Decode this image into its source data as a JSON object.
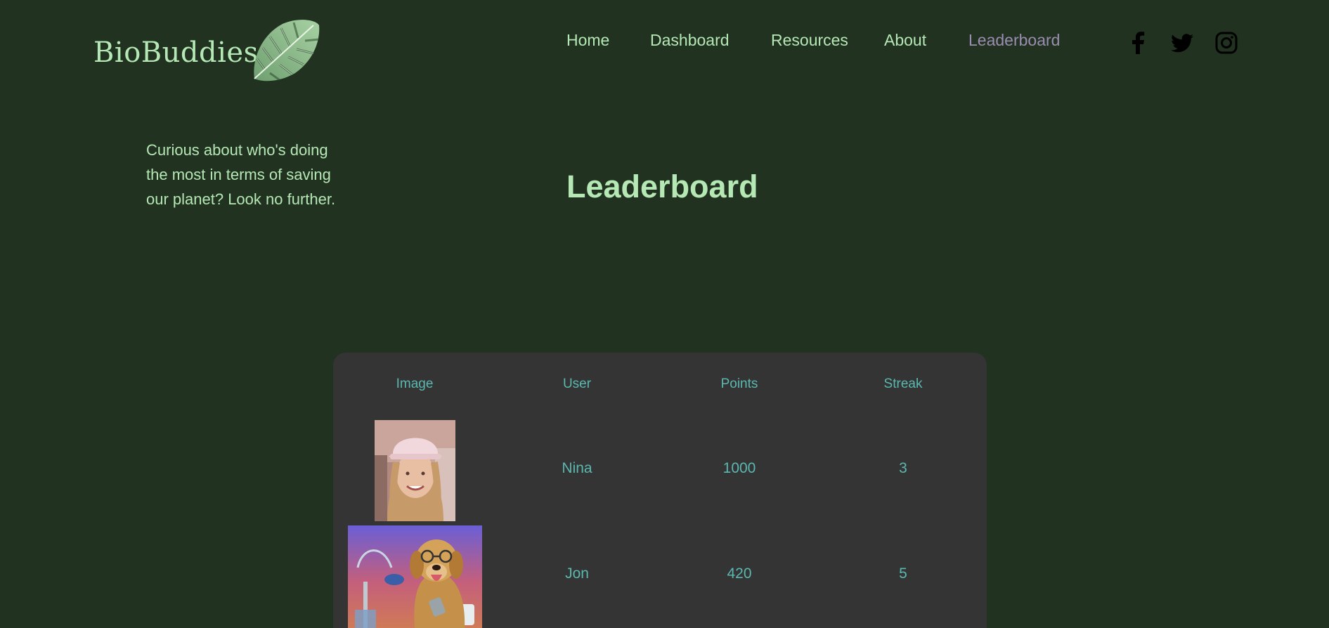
{
  "brand": {
    "name": "BioBuddies",
    "logo_icon": "monstera-leaf-icon"
  },
  "nav": {
    "items": [
      {
        "label": "Home",
        "active": false
      },
      {
        "label": "Dashboard",
        "active": false
      },
      {
        "label": "Resources",
        "active": false
      },
      {
        "label": "About",
        "active": false
      },
      {
        "label": "Leaderboard",
        "active": true
      }
    ]
  },
  "social": {
    "icons": [
      "facebook-icon",
      "twitter-icon",
      "instagram-icon"
    ]
  },
  "intro": {
    "text": "Curious about who's doing the most in terms of saving our planet? Look no further."
  },
  "page": {
    "title": "Leaderboard"
  },
  "leaderboard": {
    "columns": [
      "Image",
      "User",
      "Points",
      "Streak"
    ],
    "rows": [
      {
        "user": "Nina",
        "points": "1000",
        "streak": "3",
        "avatar": "user-photo-nina"
      },
      {
        "user": "Jon",
        "points": "420",
        "streak": "5",
        "avatar": "dog-photo-jon"
      }
    ]
  },
  "colors": {
    "background": "#213221",
    "accent_text": "#b5e8b4",
    "active_nav": "#9a8db0",
    "table_bg": "#343434",
    "table_text": "#5ab8b0"
  }
}
